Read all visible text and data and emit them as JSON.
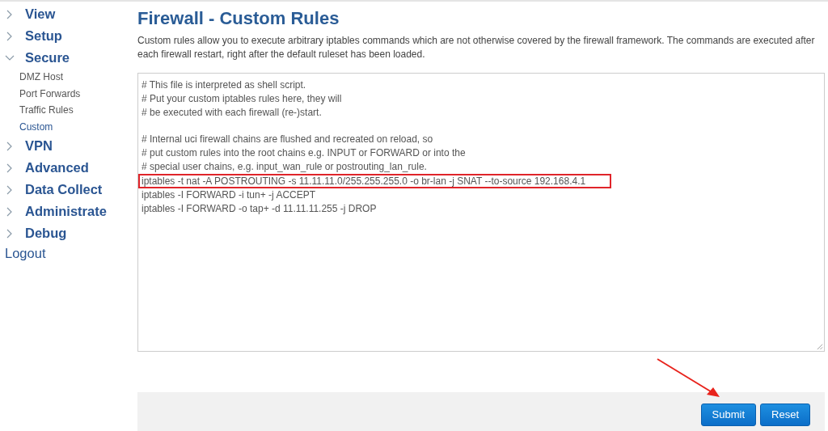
{
  "sidebar": {
    "items": [
      {
        "label": "View",
        "expanded": false
      },
      {
        "label": "Setup",
        "expanded": false
      },
      {
        "label": "Secure",
        "expanded": true,
        "children": [
          {
            "label": "DMZ Host",
            "selected": false
          },
          {
            "label": "Port Forwards",
            "selected": false
          },
          {
            "label": "Traffic Rules",
            "selected": false
          },
          {
            "label": "Custom",
            "selected": true
          }
        ]
      },
      {
        "label": "VPN",
        "expanded": false
      },
      {
        "label": "Advanced",
        "expanded": false
      },
      {
        "label": "Data Collect",
        "expanded": false
      },
      {
        "label": "Administrate",
        "expanded": false
      },
      {
        "label": "Debug",
        "expanded": false
      }
    ],
    "logout": "Logout"
  },
  "page": {
    "title": "Firewall - Custom Rules",
    "description": "Custom rules allow you to execute arbitrary iptables commands which are not otherwise covered by the firewall framework. The commands are executed after each firewall restart, right after the default ruleset has been loaded."
  },
  "editor": {
    "lines": [
      {
        "text": "# This file is interpreted as shell script.",
        "highlighted": false
      },
      {
        "text": "# Put your custom iptables rules here, they will",
        "highlighted": false
      },
      {
        "text": "# be executed with each firewall (re-)start.",
        "highlighted": false
      },
      {
        "highlighted": false
      },
      {
        "text": "# Internal uci firewall chains are flushed and recreated on reload, so",
        "highlighted": false
      },
      {
        "text": "# put custom rules into the root chains e.g. INPUT or FORWARD or into the",
        "highlighted": false
      },
      {
        "text": "# special user chains, e.g. input_wan_rule or postrouting_lan_rule.",
        "highlighted": false
      },
      {
        "text": "iptables -t nat -A POSTROUTING -s 11.11.11.0/255.255.255.0 -o br-lan -j SNAT --to-source 192.168.4.1",
        "highlighted": true
      },
      {
        "text": "iptables -I FORWARD -i tun+ -j ACCEPT",
        "highlighted": false
      },
      {
        "text": "iptables -I FORWARD -o tap+ -d 11.11.11.255 -j DROP",
        "highlighted": false
      }
    ]
  },
  "buttons": [
    {
      "label": "Submit"
    },
    {
      "label": "Reset"
    }
  ],
  "annotations": [
    {
      "kind": "arrow"
    }
  ]
}
